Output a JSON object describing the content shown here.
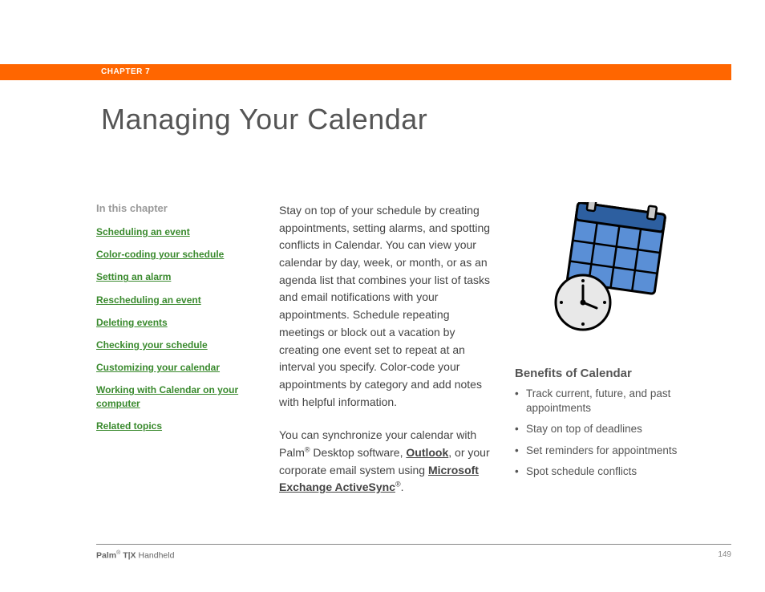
{
  "header": {
    "chapter_label": "CHAPTER 7"
  },
  "title": "Managing Your Calendar",
  "sidebar": {
    "heading": "In this chapter",
    "links": [
      "Scheduling an event",
      "Color-coding your schedule",
      "Setting an alarm",
      "Rescheduling an event",
      "Deleting events",
      "Checking your schedule",
      "Customizing your calendar",
      "Working with Calendar on your computer",
      "Related topics"
    ]
  },
  "body": {
    "para1": "Stay on top of your schedule by creating appointments, setting alarms, and spotting conflicts in Calendar. You can view your calendar by day, week, or month, or as an agenda list that combines your list of tasks and email notifications with your appointments. Schedule repeating meetings or block out a vacation by creating one event set to repeat at an interval you specify. Color-code your appointments by category and add notes with helpful information.",
    "para2_pre": "You can synchronize your calendar with Palm",
    "para2_mid": " Desktop software, ",
    "para2_link_outlook": "Outlook",
    "para2_after_outlook": ", or your corporate email system using ",
    "para2_link_activesync": "Microsoft Exchange ActiveSync",
    "registered": "®",
    "period": "."
  },
  "benefits": {
    "heading": "Benefits of Calendar",
    "items": [
      "Track current, future, and past appointments",
      "Stay on top of deadlines",
      "Set reminders for appointments",
      "Spot schedule conflicts"
    ]
  },
  "footer": {
    "brand": "Palm",
    "reg": "®",
    "model": " T|X",
    "suffix": " Handheld",
    "page": "149"
  }
}
